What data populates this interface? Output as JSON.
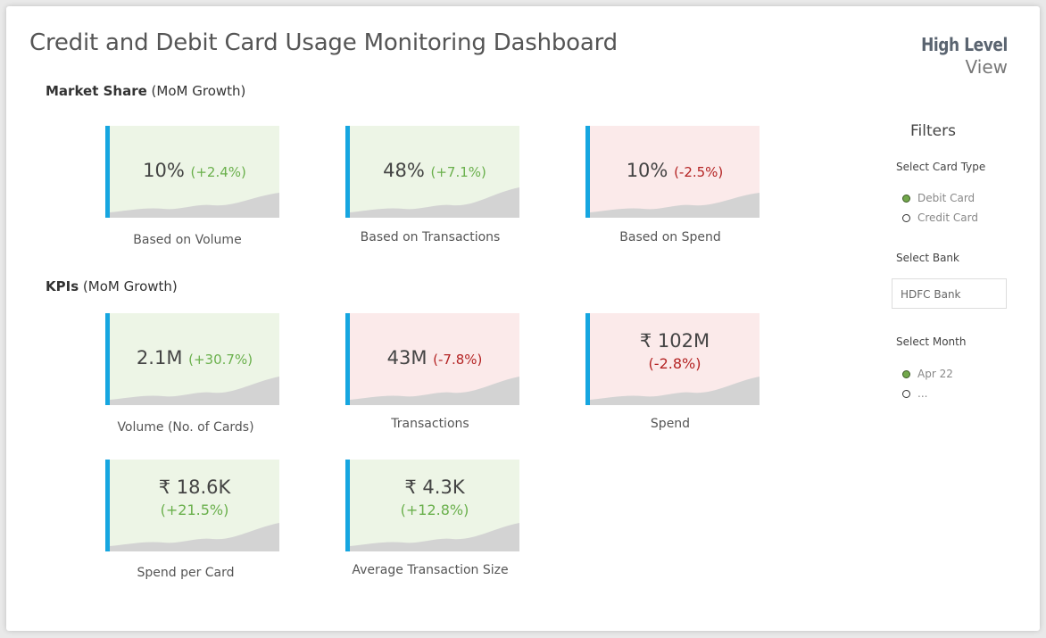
{
  "header": {
    "title": "Credit and Debit Card Usage Monitoring Dashboard",
    "brand_top": "High Level",
    "brand_bottom": "View"
  },
  "sections": {
    "market_share": {
      "bold": "Market Share",
      "note": "(MoM Growth)"
    },
    "kpis": {
      "bold": "KPIs",
      "note": "(MoM Growth)"
    }
  },
  "market_share_cards": [
    {
      "value": "10%",
      "change": "(+2.4%)",
      "caption": "Based on Volume",
      "trend": "up"
    },
    {
      "value": "48%",
      "change": "(+7.1%)",
      "caption": "Based on Transactions",
      "trend": "up"
    },
    {
      "value": "10%",
      "change": "(-2.5%)",
      "caption": "Based on Spend",
      "trend": "down"
    }
  ],
  "kpi_cards": [
    {
      "value": "2.1M",
      "change": "(+30.7%)",
      "caption": "Volume (No. of Cards)",
      "trend": "up"
    },
    {
      "value": "43M",
      "change": "(-7.8%)",
      "caption": "Transactions",
      "trend": "down"
    },
    {
      "value": "₹ 102M",
      "change": "(-2.8%)",
      "caption": "Spend",
      "trend": "down"
    },
    {
      "value": "₹ 18.6K",
      "change": "(+21.5%)",
      "caption": "Spend per Card",
      "trend": "up"
    },
    {
      "value": "₹ 4.3K",
      "change": "(+12.8%)",
      "caption": "Average Transaction Size",
      "trend": "up"
    }
  ],
  "filters": {
    "title": "Filters",
    "card_type_label": "Select Card Type",
    "card_types": [
      {
        "label": "Debit Card",
        "selected": true
      },
      {
        "label": "Credit Card",
        "selected": false
      }
    ],
    "bank_label": "Select Bank",
    "bank_value": "HDFC Bank",
    "month_label": "Select Month",
    "months": [
      {
        "label": "Apr 22",
        "selected": true
      },
      {
        "label": "...",
        "selected": false
      }
    ]
  },
  "colors": {
    "accent_bar": "#16a6e0",
    "positive": "#6ab04c",
    "negative": "#b42323",
    "card_up_bg": "#edf5e6",
    "card_down_bg": "#fbeaea"
  }
}
